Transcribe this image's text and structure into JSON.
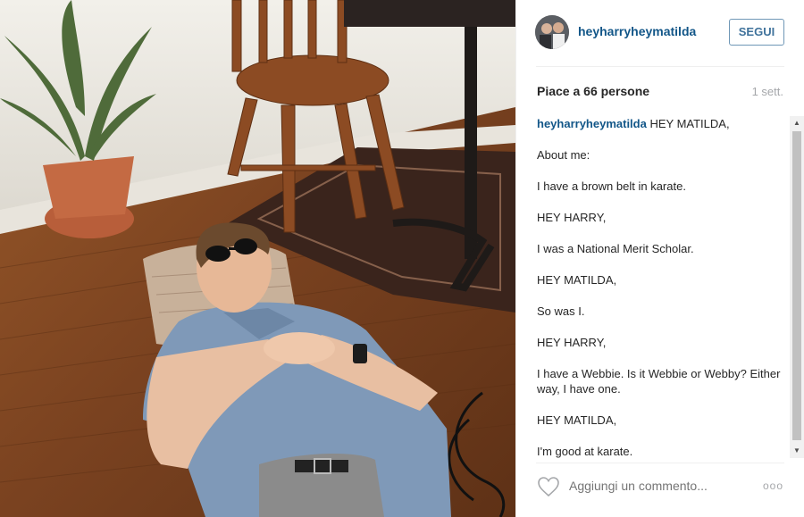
{
  "photo": {
    "alt": "Man in sunglasses lying on wooden floor next to chair"
  },
  "header": {
    "username": "heyharryheymatilda",
    "follow_label": "SEGUI"
  },
  "stats": {
    "likes": "Piace a 66 persone",
    "time": "1 sett."
  },
  "caption": {
    "author": "heyharryheymatilda",
    "first_line": "HEY MATILDA,",
    "lines": [
      "About me:",
      "I have a brown belt in karate.",
      "HEY HARRY,",
      "I was a National Merit Scholar.",
      "HEY MATILDA,",
      "So was I.",
      "HEY HARRY,",
      "I have a Webbie. Is it Webbie or Webby? Either way, I have one.",
      "HEY MATILDA,",
      "I'm good at karate."
    ]
  },
  "footer": {
    "comment_placeholder": "Aggiungi un commento...",
    "more_label": "ooo"
  },
  "icons": {
    "heart": "heart-icon",
    "more": "more-options-icon",
    "scroll_up": "scroll-up-arrow",
    "scroll_down": "scroll-down-arrow"
  },
  "colors": {
    "link": "#125688",
    "button": "#3f729b",
    "muted": "#a5a7aa"
  }
}
